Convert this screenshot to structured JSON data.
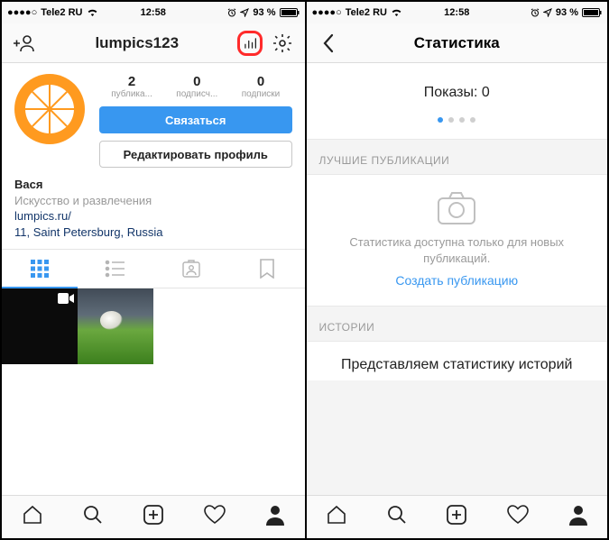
{
  "status": {
    "carrier": "Tele2 RU",
    "time": "12:58",
    "battery": "93 %"
  },
  "left": {
    "username": "lumpics123",
    "stats": [
      {
        "value": "2",
        "label": "публика..."
      },
      {
        "value": "0",
        "label": "подписч..."
      },
      {
        "value": "0",
        "label": "подписки"
      }
    ],
    "contact_btn": "Связаться",
    "edit_btn": "Редактировать профиль",
    "bio": {
      "name": "Вася",
      "category": "Искусство и развлечения",
      "website": "lumpics.ru/",
      "address": "11, Saint Petersburg, Russia"
    }
  },
  "right": {
    "title": "Статистика",
    "impressions_label": "Показы:",
    "impressions_value": "0",
    "sections": {
      "best": "ЛУЧШИЕ ПУБЛИКАЦИИ",
      "stories": "ИСТОРИИ"
    },
    "best_note": "Статистика доступна только для новых публикаций.",
    "create_link": "Создать публикацию",
    "stories_headline": "Представляем статистику историй"
  }
}
